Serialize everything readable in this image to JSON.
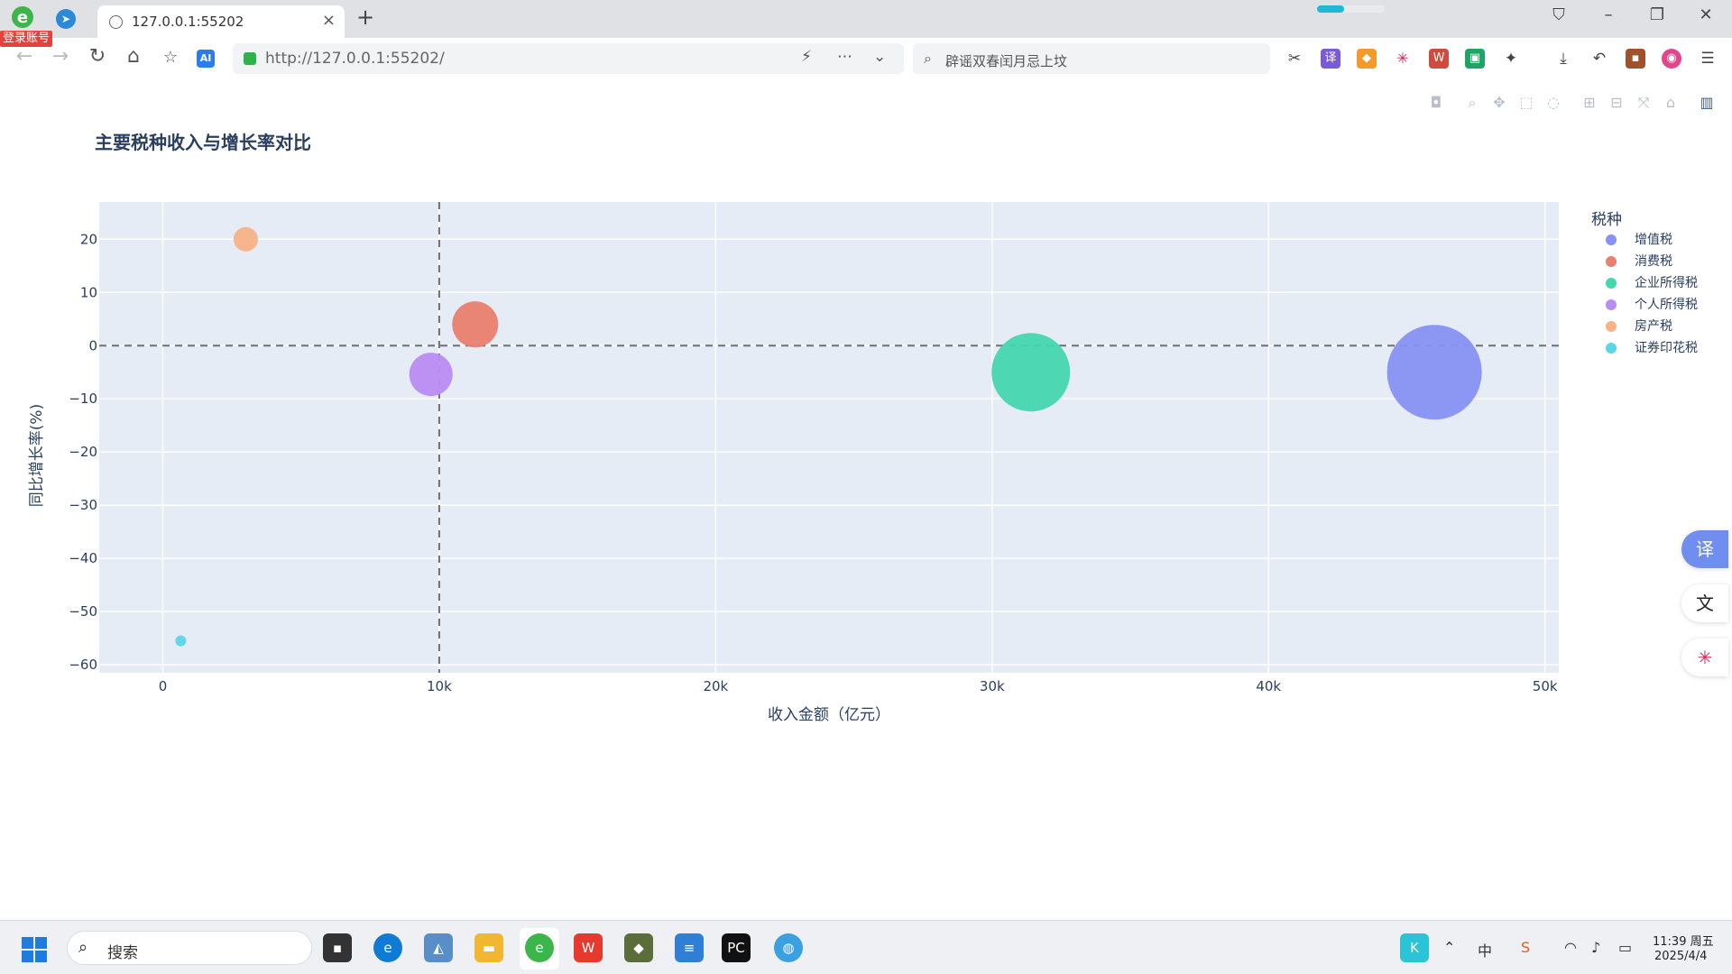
{
  "browser": {
    "login_badge": "登录账号",
    "tab_title": "127.0.0.1:55202",
    "tab_close": "×",
    "new_tab": "+",
    "url": "http://127.0.0.1:55202/",
    "search_text": "辟谣双春闰月忌上坟",
    "ai_label": "AI",
    "loading_progress": 0.4
  },
  "modebar": {
    "icons": [
      "camera-icon",
      "zoom-icon",
      "pan-icon",
      "box-select-icon",
      "lasso-icon",
      "zoom-in-icon",
      "zoom-out-icon",
      "autoscale-icon",
      "reset-axes-icon",
      "plotly-logo-icon"
    ]
  },
  "chart_data": {
    "type": "scatter",
    "title": "主要税种收入与增长率对比",
    "xlabel": "收入金额（亿元）",
    "ylabel": "同比增长率(%)",
    "xlim": [
      -2300,
      50500
    ],
    "ylim": [
      -61.5,
      27
    ],
    "x_ticks": [
      0,
      10000,
      20000,
      30000,
      40000,
      50000
    ],
    "x_tick_labels": [
      "0",
      "10k",
      "20k",
      "30k",
      "40k",
      "50k"
    ],
    "y_ticks": [
      20,
      10,
      0,
      -10,
      -20,
      -30,
      -40,
      -50,
      -60
    ],
    "y_tick_labels": [
      "20",
      "10",
      "0",
      "−10",
      "−20",
      "−30",
      "−40",
      "−50",
      "−60"
    ],
    "reference_lines": {
      "x": 10000,
      "y": 0,
      "style": "dashed"
    },
    "legend_title": "税种",
    "legend_position": "right",
    "grid": true,
    "series": [
      {
        "name": "增值税",
        "color": "#8792f3",
        "x": 46000,
        "y": -5,
        "size": 35
      },
      {
        "name": "消费税",
        "color": "#e8806e",
        "x": 11300,
        "y": 4,
        "size": 17
      },
      {
        "name": "企业所得税",
        "color": "#45d6ae",
        "x": 31400,
        "y": -5,
        "size": 29
      },
      {
        "name": "个人所得税",
        "color": "#b98cf2",
        "x": 9700,
        "y": -5.4,
        "size": 16
      },
      {
        "name": "房产税",
        "color": "#f7b387",
        "x": 3000,
        "y": 20,
        "size": 9
      },
      {
        "name": "证券印花税",
        "color": "#5ad6e8",
        "x": 650,
        "y": -55.5,
        "size": 4
      }
    ]
  },
  "floating": {
    "translate_label": "译"
  },
  "taskbar": {
    "search_placeholder": "搜索",
    "time": "11:39 周五",
    "date": "2025/4/4",
    "tray_ime": "中"
  }
}
